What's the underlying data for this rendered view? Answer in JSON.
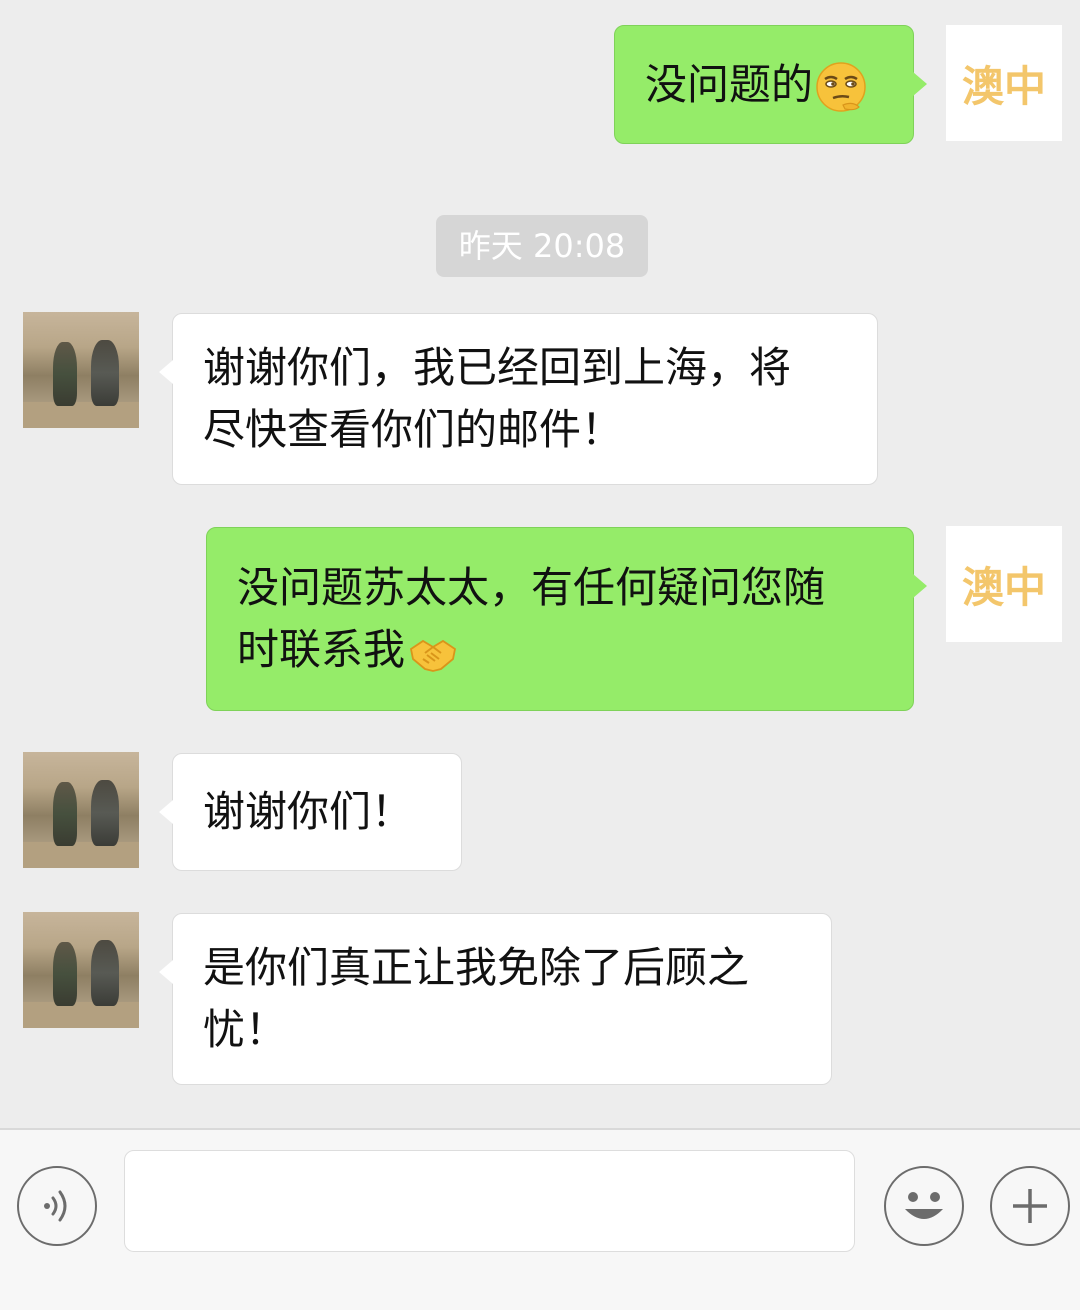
{
  "messages": [
    {
      "sender": "self",
      "text": "没问题的",
      "emoji": "smirk-emoji"
    },
    {
      "sender": "other",
      "lines": [
        "谢谢你们，我已经回到上海，将",
        "尽快查看你们的邮件！"
      ]
    },
    {
      "sender": "self",
      "lines": [
        "没问题苏太太，有任何疑问您随",
        "时联系我"
      ],
      "emoji": "handshake-emoji"
    },
    {
      "sender": "other",
      "text": "谢谢你们！"
    },
    {
      "sender": "other",
      "lines": [
        "是你们真正让我免除了后顾之",
        "忧！"
      ]
    }
  ],
  "timestamp": "昨天 20:08",
  "self_avatar_text": "澳中",
  "colors": {
    "self_bubble": "#95ec69",
    "other_bubble": "#ffffff",
    "background": "#ededed",
    "brand": "#f3c66b"
  },
  "input_bar": {
    "voice_icon": "voice-icon",
    "emoji_icon": "smiley-icon",
    "plus_icon": "plus-icon",
    "input_value": ""
  }
}
